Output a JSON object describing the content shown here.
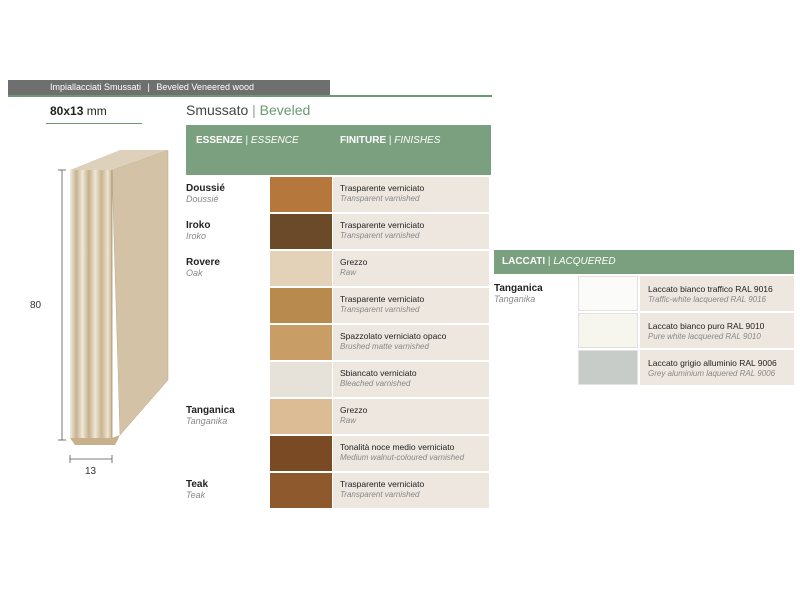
{
  "header": {
    "category_it": "Impiallacciati Smussati",
    "separator": "|",
    "category_en": "Beveled Veneered wood"
  },
  "dimensions": {
    "size": "80x13",
    "unit": "mm",
    "height_label": "80",
    "width_label": "13"
  },
  "section": {
    "title_it": "Smussato",
    "separator": "|",
    "title_en": "Beveled"
  },
  "table_header": {
    "essence_it": "ESSENZE",
    "essence_en": "ESSENCE",
    "finish_it": "FINITURE",
    "finish_en": "FINISHES",
    "separator": "|"
  },
  "rows": [
    {
      "essence_it": "Doussié",
      "essence_en": "Doussié",
      "finish_it": "Trasparente verniciato",
      "finish_en": "Transparent varnished",
      "swatch": "#b5773c"
    },
    {
      "essence_it": "Iroko",
      "essence_en": "Iroko",
      "finish_it": "Trasparente verniciato",
      "finish_en": "Transparent varnished",
      "swatch": "#6a4a28"
    },
    {
      "essence_it": "Rovere",
      "essence_en": "Oak",
      "finish_it": "Grezzo",
      "finish_en": "Raw",
      "swatch": "#e3d2b8"
    },
    {
      "essence_it": "",
      "essence_en": "",
      "finish_it": "Trasparente verniciato",
      "finish_en": "Transparent varnished",
      "swatch": "#b88a4e"
    },
    {
      "essence_it": "",
      "essence_en": "",
      "finish_it": "Spazzolato verniciato opaco",
      "finish_en": "Brushed matte varnished",
      "swatch": "#c89e66"
    },
    {
      "essence_it": "",
      "essence_en": "",
      "finish_it": "Sbiancato verniciato",
      "finish_en": "Bleached varnished",
      "swatch": "#e6e1d9"
    },
    {
      "essence_it": "Tanganica",
      "essence_en": "Tanganika",
      "finish_it": "Grezzo",
      "finish_en": "Raw",
      "swatch": "#dcbc95"
    },
    {
      "essence_it": "",
      "essence_en": "",
      "finish_it": "Tonalità noce medio verniciato",
      "finish_en": "Medium walnut-coloured varnished",
      "swatch": "#7a4a25"
    },
    {
      "essence_it": "Teak",
      "essence_en": "Teak",
      "finish_it": "Trasparente verniciato",
      "finish_en": "Transparent varnished",
      "swatch": "#8e5a2d"
    }
  ],
  "lacquered": {
    "header_it": "LACCATI",
    "header_en": "LACQUERED",
    "separator": "|",
    "essence_it": "Tanganica",
    "essence_en": "Tanganika",
    "items": [
      {
        "name": "Laccato bianco traffico RAL 9016",
        "name_en": "Traffic-white lacquered RAL 9016",
        "swatch": "#fbfbfa"
      },
      {
        "name": "Laccato bianco puro RAL 9010",
        "name_en": "Pure white lacquered RAL 9010",
        "swatch": "#f7f6ee"
      },
      {
        "name": "Laccato grigio alluminio RAL 9006",
        "name_en": "Grey aluminium laquered RAL 9006",
        "swatch": "#c8ccc8"
      }
    ]
  },
  "colors": {
    "green": "#7ba07f",
    "finish_bg": "#ede7e0",
    "topbar": "#6f6f6f"
  }
}
